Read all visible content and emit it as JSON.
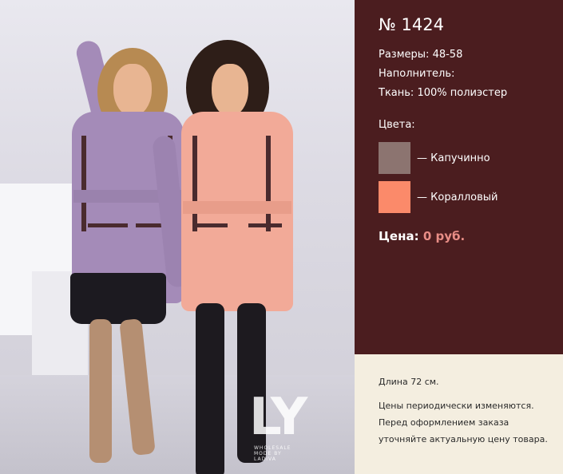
{
  "product": {
    "title": "№ 1424",
    "specs": [
      {
        "key": "Размеры:",
        "value": "48-58"
      },
      {
        "key": "Наполнитель:",
        "value": ""
      },
      {
        "key": "Ткань:",
        "value": "100% полиэстер"
      }
    ],
    "colors_label": "Цвета:",
    "colors": [
      {
        "name": "— Капучинно",
        "hex": "#8c7470"
      },
      {
        "name": "— Коралловый",
        "hex": "#fb8a6a"
      }
    ],
    "price_label": "Цена:",
    "price_value": "0 руб."
  },
  "note": {
    "length": "Длина 72 см.",
    "disclaimer_lines": [
      "Цены периодически изменяются.",
      "Перед оформлением заказа",
      "уточняйте актуальную цену товара."
    ]
  },
  "brand_mark": {
    "logo_text": "LY",
    "sub_text": "WHOLESALE MODE BY LADIVA"
  },
  "colors": {
    "panel_bg": "#4b1d1f",
    "note_bg": "#f4eee0",
    "price_accent": "#e88d86",
    "lilac_coat": "#a48bb8",
    "coral_coat": "#f2aa98"
  }
}
